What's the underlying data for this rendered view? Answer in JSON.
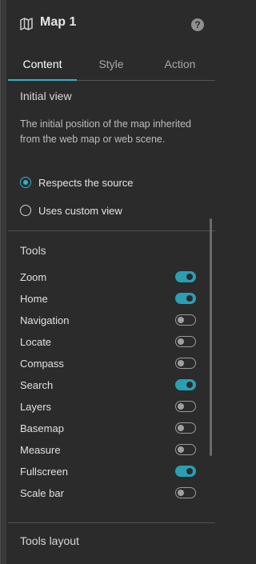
{
  "header": {
    "title": "Map 1",
    "help": "?"
  },
  "tabs": [
    {
      "label": "Content",
      "active": true
    },
    {
      "label": "Style",
      "active": false
    },
    {
      "label": "Action",
      "active": false
    }
  ],
  "initial_view": {
    "title": "Initial view",
    "description": "The initial position of the map inherited from the web map or web scene.",
    "options": [
      {
        "label": "Respects the source",
        "selected": true
      },
      {
        "label": "Uses custom view",
        "selected": false
      }
    ]
  },
  "tools": {
    "title": "Tools",
    "items": [
      {
        "label": "Zoom",
        "on": true
      },
      {
        "label": "Home",
        "on": true
      },
      {
        "label": "Navigation",
        "on": false
      },
      {
        "label": "Locate",
        "on": false
      },
      {
        "label": "Compass",
        "on": false
      },
      {
        "label": "Search",
        "on": true
      },
      {
        "label": "Layers",
        "on": false
      },
      {
        "label": "Basemap",
        "on": false
      },
      {
        "label": "Measure",
        "on": false
      },
      {
        "label": "Fullscreen",
        "on": true
      },
      {
        "label": "Scale bar",
        "on": false
      }
    ]
  },
  "tools_layout": {
    "title": "Tools layout"
  },
  "colors": {
    "accent": "#2fb3c9",
    "background": "#2b2b2b"
  }
}
